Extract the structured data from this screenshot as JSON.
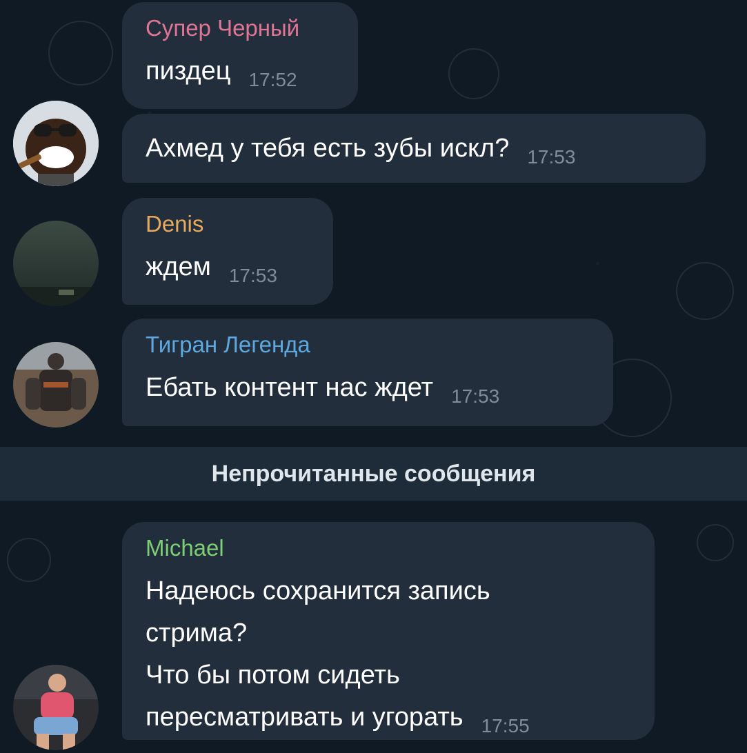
{
  "messages": [
    {
      "sender": "Супер Черный",
      "sender_color": "#e07595",
      "lines": [
        "пиздец"
      ],
      "time": "17:52"
    },
    {
      "sender": "",
      "lines": [
        "Ахмед у тебя есть зубы искл?"
      ],
      "time": "17:53"
    },
    {
      "sender": "Denis",
      "sender_color": "#e6a95e",
      "lines": [
        "ждем"
      ],
      "time": "17:53"
    },
    {
      "sender": "Тигран Легенда",
      "sender_color": "#5ea8e0",
      "lines": [
        "Ебать контент нас ждет"
      ],
      "time": "17:53"
    },
    {
      "sender": "Michael",
      "sender_color": "#7ccf72",
      "lines": [
        "Надеюсь сохранится запись",
        "стрима?",
        "Что бы потом сидеть",
        "пересматривать и угорать"
      ],
      "time": "17:55"
    }
  ],
  "unread_divider": {
    "label": "Непрочитанные сообщения"
  }
}
